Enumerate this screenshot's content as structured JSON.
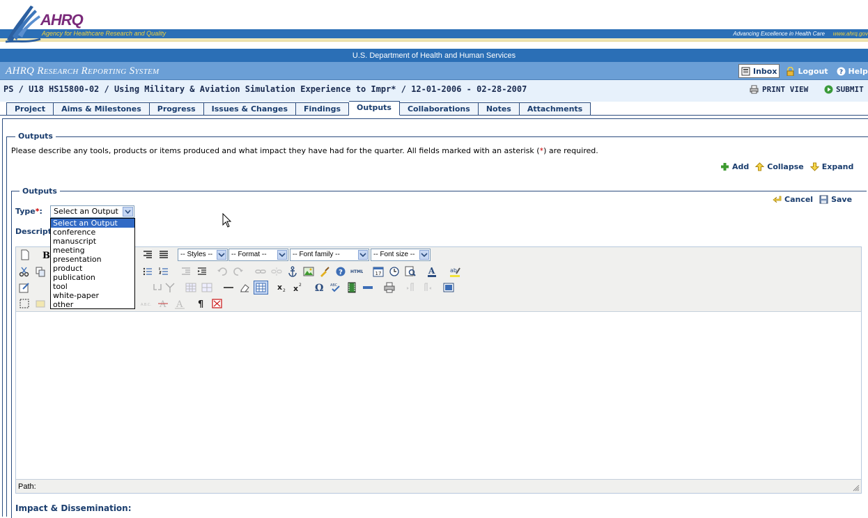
{
  "banner": {
    "logo_text": "AHRQ",
    "agency_name": "Agency for Healthcare Research and Quality",
    "tagline": "Advancing Excellence in Health Care",
    "site_url": "www.ahrq.gov",
    "department": "U.S. Department of Health and Human Services"
  },
  "app": {
    "title": "AHRQ Research Reporting System",
    "nav": {
      "inbox": "Inbox",
      "logout": "Logout",
      "help": "Help"
    }
  },
  "project": {
    "title": "PS / U18 HS15800-02 / Using Military & Aviation Simulation Experience to Impr* / 12-01-2006 - 02-28-2007",
    "print_view": "PRINT VIEW",
    "submit": "SUBMIT"
  },
  "tabs": [
    "Project",
    "Aims & Milestones",
    "Progress",
    "Issues & Changes",
    "Findings",
    "Outputs",
    "Collaborations",
    "Notes",
    "Attachments"
  ],
  "active_tab": "Outputs",
  "section": {
    "legend": "Outputs",
    "instructions_before": "Please describe any tools, products or items produced and what impact they have had for the quarter. All fields marked with an asterisk (",
    "asterisk": "*",
    "instructions_after": ") are required.",
    "add": "Add",
    "collapse": "Collapse",
    "expand": "Expand"
  },
  "output_form": {
    "legend": "Outputs",
    "cancel": "Cancel",
    "save": "Save",
    "type_label": "Type",
    "required_mark": "*",
    "type_colon": ":",
    "type_value": "Select an Output",
    "type_options": [
      "Select an Output",
      "conference",
      "manuscript",
      "meeting",
      "presentation",
      "product",
      "publication",
      "tool",
      "white-paper",
      "other"
    ],
    "description_label": "Description:",
    "impact_label": "Impact & Dissemination:"
  },
  "editor": {
    "styles": "-- Styles --",
    "format": "-- Format --",
    "font_family": "-- Font family --",
    "font_size": "-- Font size --",
    "path_label": "Path:"
  },
  "colors": {
    "header_blue": "#2b6fb6",
    "title_bar": "#6b9fd6",
    "label_blue": "#1a3d6e",
    "required_red": "#cc0000",
    "selection_blue": "#316ac5"
  }
}
